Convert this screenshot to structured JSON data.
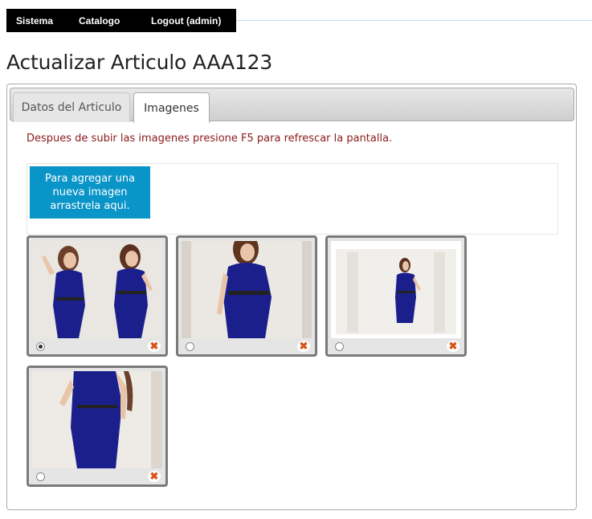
{
  "nav": {
    "items": [
      {
        "label": "Sistema"
      },
      {
        "label": "Catalogo"
      },
      {
        "label": "Logout (admin)"
      }
    ]
  },
  "page": {
    "title": "Actualizar Articulo AAA123"
  },
  "tabs": [
    {
      "label": "Datos del Articulo",
      "active": false
    },
    {
      "label": "Imagenes",
      "active": true
    }
  ],
  "notice": "Despues de subir las imagenes presione F5 para refrescar la pantalla.",
  "dropzone": {
    "label": "Para agregar una nueva imagen arrastrela aqui."
  },
  "images": [
    {
      "primary": true,
      "delete_icon": "delete-x-icon"
    },
    {
      "primary": false,
      "delete_icon": "delete-x-icon"
    },
    {
      "primary": false,
      "delete_icon": "delete-x-icon"
    },
    {
      "primary": false,
      "delete_icon": "delete-x-icon"
    }
  ],
  "colors": {
    "navbar": "#000000",
    "accent_blue": "#0a95c8",
    "notice_red": "#8b1a1a",
    "delete_orange": "#d9541a",
    "dress_blue": "#1b1f8c"
  }
}
